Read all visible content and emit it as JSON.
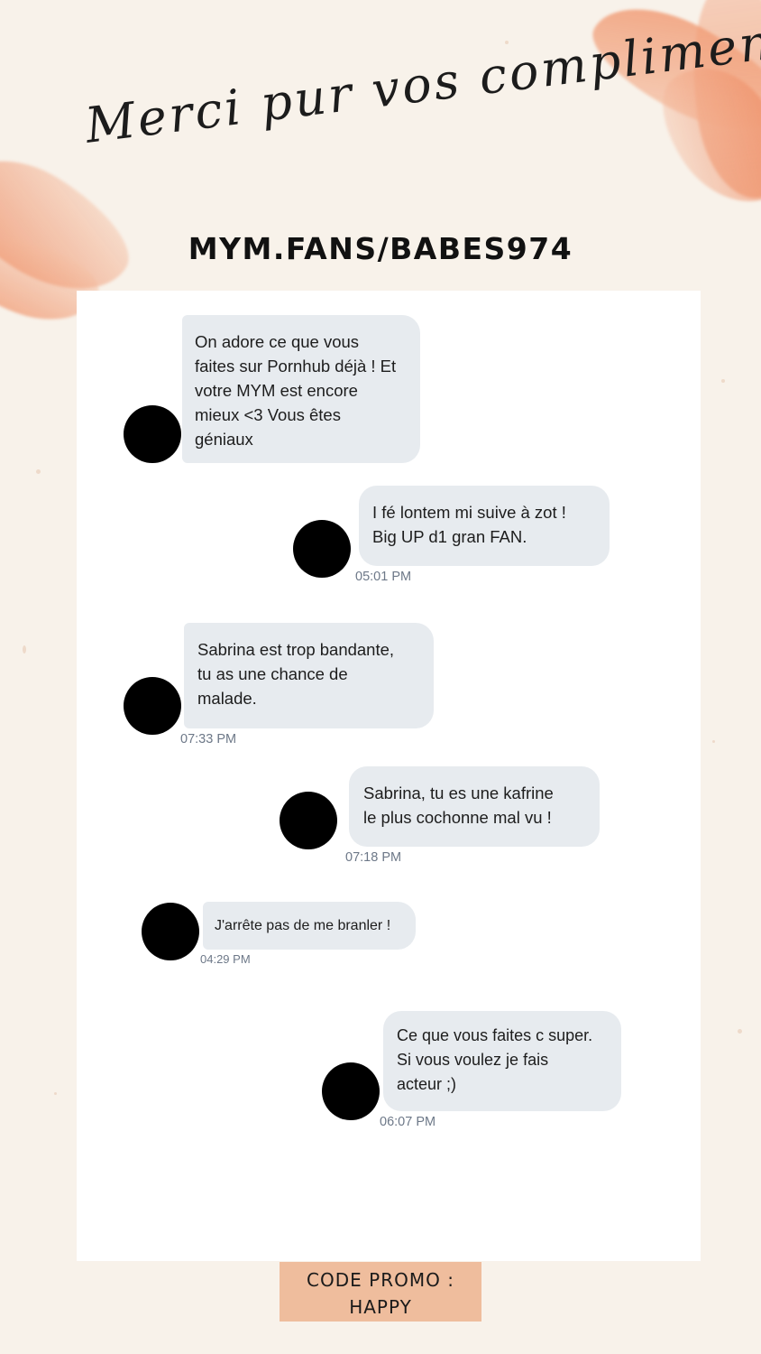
{
  "title": "Merci pur vos compliments...",
  "url_heading": "MYM.FANS/BABES974",
  "messages": [
    {
      "text": "On adore ce que vous\nfaites sur Pornhub déjà ! Et\nvotre MYM est encore\nmieux <3 Vous êtes\ngéniaux",
      "time": ""
    },
    {
      "text": "I fé lontem mi suive à zot !\nBig UP d1 gran FAN.",
      "time": "05:01 PM"
    },
    {
      "text": "Sabrina est trop bandante,\ntu as une chance de\nmalade.",
      "time": "07:33 PM"
    },
    {
      "text": "Sabrina, tu es une kafrine\nle plus cochonne mal vu !",
      "time": "07:18 PM"
    },
    {
      "text": "J'arrête pas de me branler !",
      "time": "04:29 PM"
    },
    {
      "text": "Ce que vous faites c super.\nSi vous voulez je fais\nacteur ;)",
      "time": "06:07 PM"
    }
  ],
  "promo": {
    "line1": "CODE PROMO :",
    "line2": "HAPPY"
  },
  "colors": {
    "background": "#f8f2ea",
    "bubble": "#e7ebef",
    "brush": "#f0966e",
    "promo_box": "#efbd9d",
    "timestamp": "#6d7888"
  }
}
